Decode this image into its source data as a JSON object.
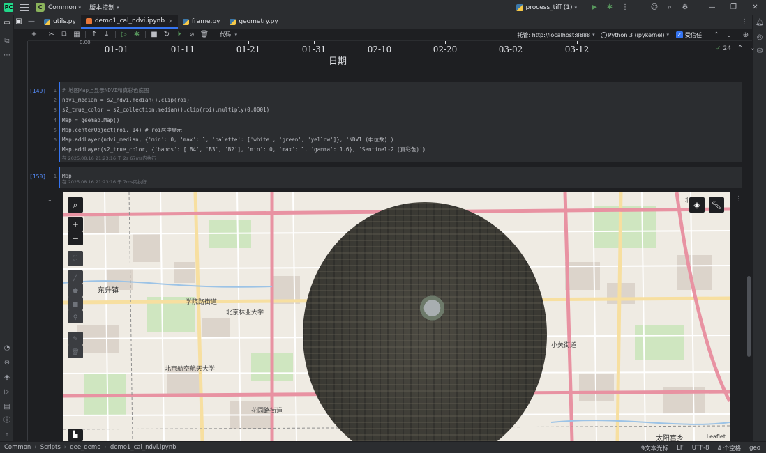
{
  "titlebar": {
    "logo": "PC",
    "project_badge": "C",
    "project_name": "Common",
    "vcs_label": "版本控制",
    "run_config": "process_tiff (1)",
    "icons": [
      "run-icon",
      "debug-icon",
      "more-icon",
      "account-icon",
      "search-icon",
      "settings-icon"
    ],
    "window_controls": [
      "minimize",
      "restore",
      "close"
    ]
  },
  "tabs": [
    {
      "label": "utils.py",
      "type": "python",
      "active": false
    },
    {
      "label": "demo1_cal_ndvi.ipynb",
      "type": "notebook",
      "active": true
    },
    {
      "label": "frame.py",
      "type": "python",
      "active": false
    },
    {
      "label": "geometry.py",
      "type": "python",
      "active": false
    }
  ],
  "notebook_toolbar": {
    "cell_type": "代码",
    "managed_by": "托管: http://localhost:8888",
    "kernel": "Python 3 (ipykernel)",
    "trusted": "受信任"
  },
  "inspections": {
    "count": "24"
  },
  "chart_axis": {
    "ticks": [
      "01-01",
      "01-11",
      "01-21",
      "01-31",
      "02-10",
      "02-20",
      "03-02",
      "03-12"
    ],
    "xlabel": "日期"
  },
  "cell149": {
    "exec": "[149]",
    "lines": [
      "# 地图Map上显示NDVI和真彩色底图",
      "ndvi_median = s2_ndvi.median().clip(roi)",
      "s2_true_color = s2_collection.median().clip(roi).multiply(0.0001)",
      "Map = geemap.Map()",
      "Map.centerObject(roi, 14)  # roi居中显示",
      "Map.addLayer(ndvi_median, {'min': 0, 'max': 1, 'palette': ['white', 'green', 'yellow']}, 'NDVI (中位数)')",
      "Map.addLayer(s2_true_color, {'bands': ['B4', 'B3', 'B2'], 'min': 0, 'max': 1, 'gamma': 1.6}, 'Sentinel-2 (真彩色)')"
    ],
    "meta": "在 2025.08.16 21:23:16 于 2s 67ms内执行"
  },
  "cell150": {
    "exec": "[150]",
    "lines": [
      "Map"
    ],
    "meta": "在 2025.08.16 21:23:16 于 7ms内执行"
  },
  "map": {
    "labels": {
      "dongsheng": "东升镇",
      "xueyuanlu": "学院路街道",
      "beijing_forestry": "北京林业大学",
      "beihang": "北京航空航天大学",
      "huayuanlu": "花园路街道",
      "taiyanggong": "太阳宫乡",
      "xiaoguan": "小关街道",
      "beiyuan": "北苑"
    },
    "controls": [
      "search-icon",
      "zoom-in",
      "zoom-out",
      "fullscreen",
      "draw-line",
      "draw-polygon",
      "draw-rectangle",
      "draw-marker",
      "layers-icon",
      "wrench-icon"
    ],
    "zoom_in": "+",
    "zoom_out": "−",
    "attribution": "Leaflet"
  },
  "statusbar": {
    "crumbs": [
      "Common",
      "Scripts",
      "gee_demo",
      "demo1_cal_ndvi.ipynb"
    ],
    "chars": "9文本光标",
    "line_ending": "LF",
    "encoding": "UTF-8",
    "indent": "4 个空格",
    "interpreter": "geo"
  }
}
